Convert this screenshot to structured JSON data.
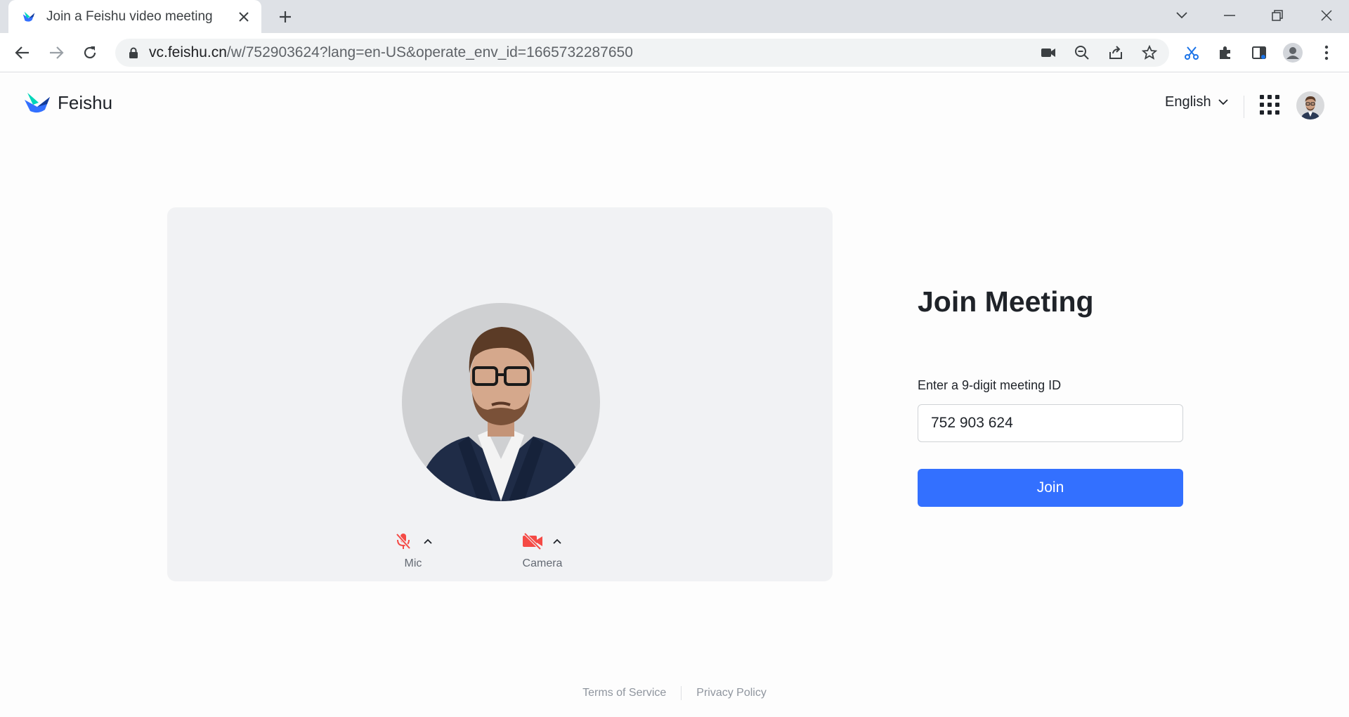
{
  "browser": {
    "tab_title": "Join a Feishu video meeting",
    "url_host": "vc.feishu.cn",
    "url_path": "/w/752903624?lang=en-US&operate_env_id=1665732287650"
  },
  "header": {
    "brand": "Feishu",
    "language": "English"
  },
  "preview": {
    "mic_label": "Mic",
    "camera_label": "Camera",
    "mic_state": "muted",
    "camera_state": "off"
  },
  "join": {
    "title": "Join Meeting",
    "id_label": "Enter a 9-digit meeting ID",
    "id_value": "752 903 624",
    "button_label": "Join"
  },
  "footer": {
    "terms": "Terms of Service",
    "privacy": "Privacy Policy"
  },
  "colors": {
    "accent": "#3370ff",
    "muted_red": "#f54a45"
  }
}
